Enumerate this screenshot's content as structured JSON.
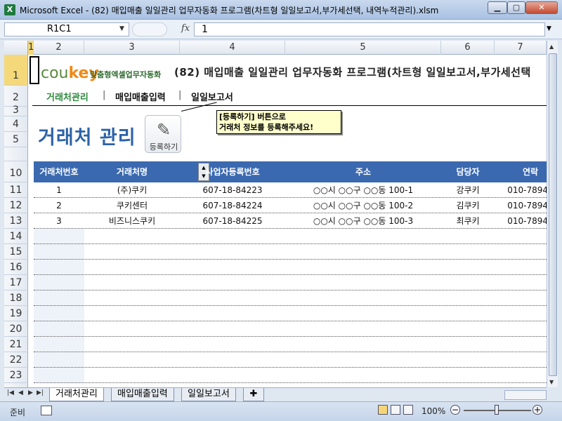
{
  "window": {
    "app_icon": "X",
    "title": "Microsoft Excel - (82) 매입매출 일일관리 업무자동화 프로그램(차트형 일일보고서,부가세선택, 내역누적관리).xlsm",
    "minimize_label": "▁",
    "maximize_label": "▢",
    "close_label": "✕"
  },
  "formula_bar": {
    "name_box": "R1C1",
    "fx_label": "fx",
    "value": "1"
  },
  "columns": [
    "1",
    "2",
    "3",
    "4",
    "5",
    "6",
    "7"
  ],
  "rows": [
    "1",
    "2",
    "3",
    "4",
    "5",
    "",
    "10",
    "11",
    "12",
    "13",
    "14",
    "15",
    "16",
    "17",
    "18",
    "19",
    "20",
    "21",
    "22",
    "23"
  ],
  "brand": {
    "logo_cou": "cou",
    "logo_key": "key",
    "logo_sub": "맞춤형엑셀업무자동화",
    "program_title": "(82) 매입매출 일일관리 업무자동화 프로그램(차트형 일일보고서,부가세선택"
  },
  "nav": {
    "item1": "거래처관리",
    "item2": "매입매출입력",
    "item3": "일일보고서",
    "separator": "|"
  },
  "page": {
    "heading": "거래처 관리",
    "register_button": "등록하기",
    "callout_line1": "[등록하기] 버튼으로",
    "callout_line2": "거래처 정보를 등록해주세요!"
  },
  "table": {
    "headers": [
      "거래처번호",
      "거래처명",
      "사업자등록번호",
      "주소",
      "담당자",
      "연락"
    ],
    "rows": [
      [
        "1",
        "(주)쿠키",
        "607-18-84223",
        "○○시 ○○구 ○○동 100-1",
        "강쿠키",
        "010-7894"
      ],
      [
        "2",
        "쿠키센터",
        "607-18-84224",
        "○○시 ○○구 ○○동 100-2",
        "김쿠키",
        "010-7894"
      ],
      [
        "3",
        "비즈니스쿠키",
        "607-18-84225",
        "○○시 ○○구 ○○동 100-3",
        "최쿠키",
        "010-7894"
      ]
    ]
  },
  "sheet_tabs": {
    "tab1": "거래처관리",
    "tab2": "매입매출입력",
    "tab3": "일일보고서"
  },
  "status": {
    "ready": "준비",
    "zoom": "100%"
  }
}
